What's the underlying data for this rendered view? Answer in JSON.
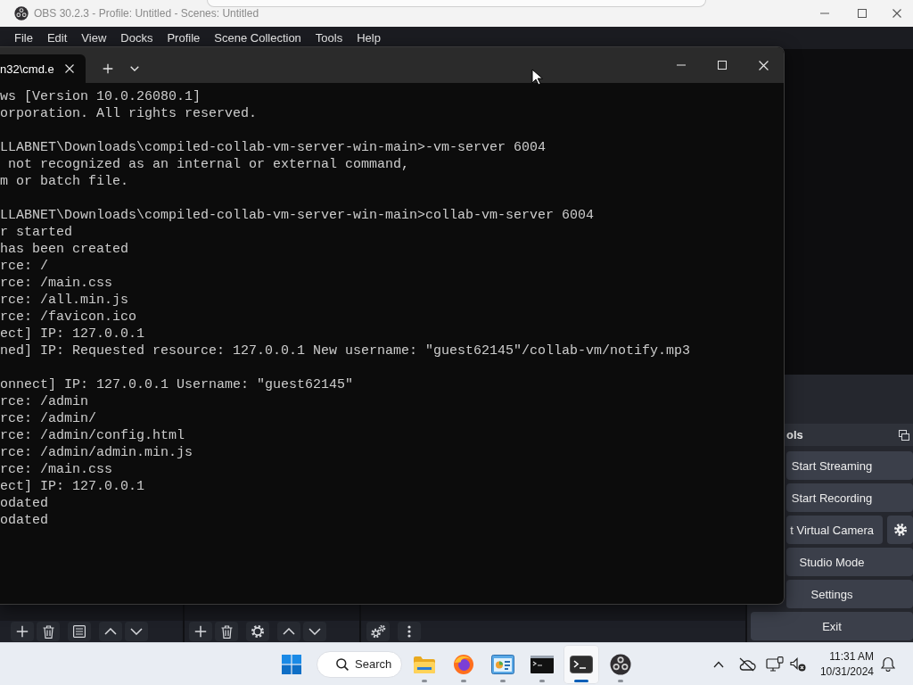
{
  "obs": {
    "title": "OBS 30.2.3 - Profile: Untitled - Scenes: Untitled",
    "menu": [
      "File",
      "Edit",
      "View",
      "Docks",
      "Profile",
      "Scene Collection",
      "Tools",
      "Help"
    ],
    "controls_dock": {
      "title": "ols",
      "buttons": [
        {
          "label": "Start Streaming",
          "kind": "plain"
        },
        {
          "label": "Start Recording",
          "kind": "plain"
        },
        {
          "label": "t Virtual Camera",
          "kind": "with-settings"
        },
        {
          "label": "Studio Mode",
          "kind": "plain"
        },
        {
          "label": "Settings",
          "kind": "plain"
        },
        {
          "label": "Exit",
          "kind": "plain"
        }
      ]
    }
  },
  "terminal": {
    "tabs": [
      {
        "title": "n32\\cmd.e",
        "selected": true
      }
    ],
    "output_blocks": [
      [
        "ws [Version 10.0.26080.1]",
        "orporation. All rights reserved."
      ],
      [
        "LLABNET\\Downloads\\compiled-collab-vm-server-win-main>-vm-server 6004",
        " not recognized as an internal or external command,",
        "m or batch file."
      ],
      [
        "LLABNET\\Downloads\\compiled-collab-vm-server-win-main>collab-vm-server 6004",
        "r started",
        "has been created",
        "rce: /",
        "rce: /main.css",
        "rce: /all.min.js",
        "rce: /favicon.ico",
        "ect] IP: 127.0.0.1",
        "ned] IP: Requested resource: 127.0.0.1 New username: \"guest62145\"/collab-vm/notify.mp3"
      ],
      [
        "onnect] IP: 127.0.0.1 Username: \"guest62145\"",
        "rce: /admin",
        "rce: /admin/",
        "rce: /admin/config.html",
        "rce: /admin/admin.min.js",
        "rce: /main.css",
        "ect] IP: 127.0.0.1",
        "odated",
        "odated"
      ]
    ]
  },
  "taskbar": {
    "search": {
      "label": "Search"
    },
    "apps": [
      {
        "kind": "folder",
        "selected": false
      },
      {
        "kind": "browser",
        "selected": false
      },
      {
        "kind": "chart-window",
        "selected": false
      },
      {
        "kind": "console",
        "selected": false
      },
      {
        "kind": "terminal",
        "selected": true
      },
      {
        "kind": "circle-logo",
        "selected": false
      }
    ],
    "clock": {
      "time": "11:31 AM",
      "date": "10/31/2024"
    }
  }
}
